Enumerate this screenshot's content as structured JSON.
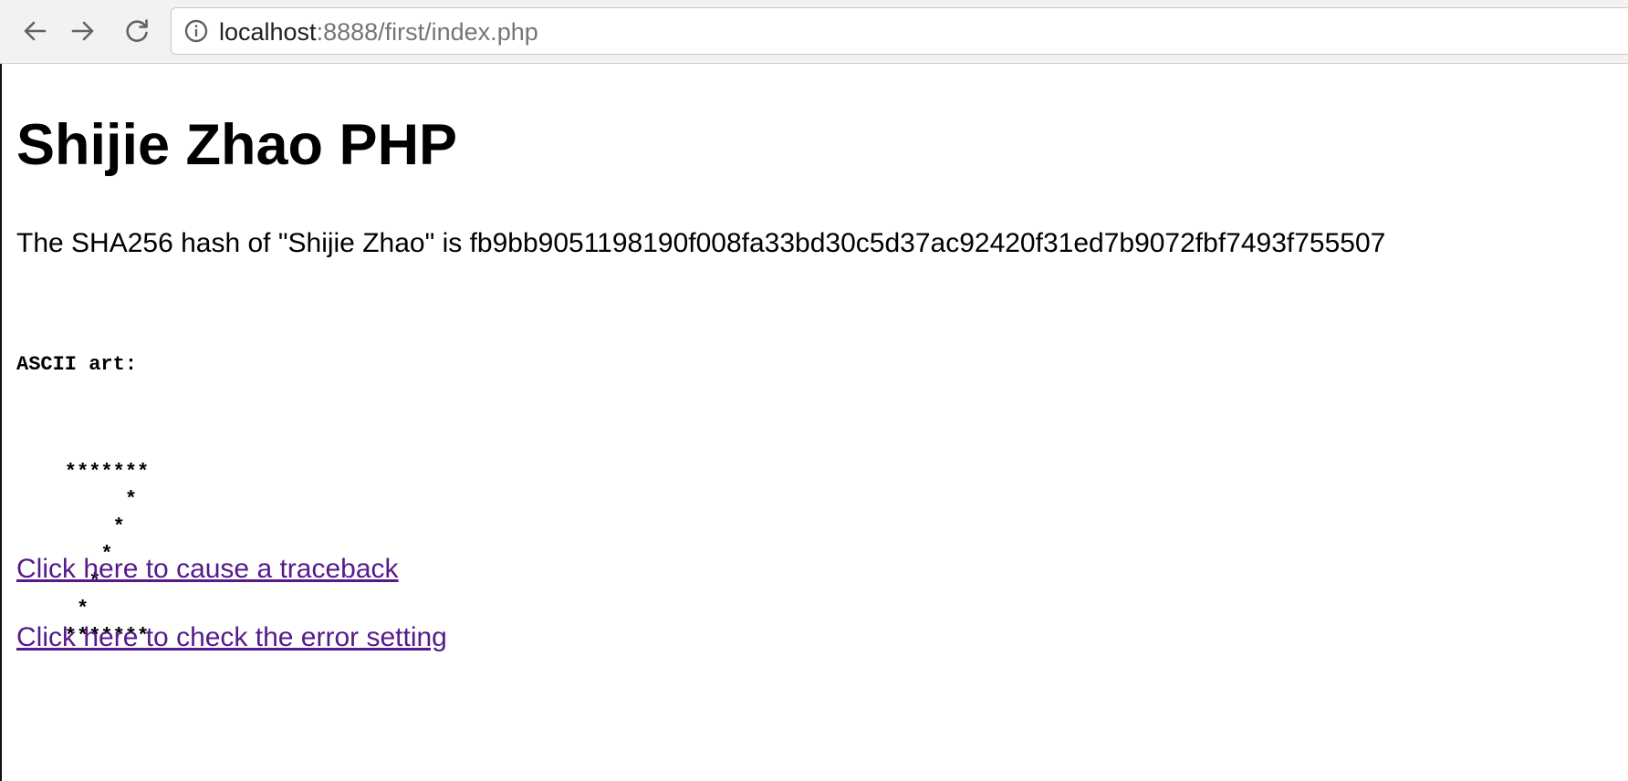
{
  "browser": {
    "url_host": "localhost",
    "url_rest": ":8888/first/index.php",
    "icons": {
      "back": "back-arrow-icon",
      "forward": "forward-arrow-icon",
      "reload": "reload-icon",
      "info": "info-icon"
    }
  },
  "page": {
    "title": "Shijie Zhao PHP",
    "hash_text": "The SHA256 hash of \"Shijie Zhao\" is fb9bb9051198190f008fa33bd30c5d37ac92420f31ed7b9072fbf7493f755507",
    "ascii_label": "ASCII art:",
    "ascii_art": "    *******\n         *\n        *\n       *\n      *\n     *\n    *******",
    "links": {
      "traceback": "Click here to cause a traceback",
      "error_setting": "Click here to check the error setting"
    },
    "colors": {
      "visited_link": "#551a8b",
      "text": "#000000"
    }
  }
}
